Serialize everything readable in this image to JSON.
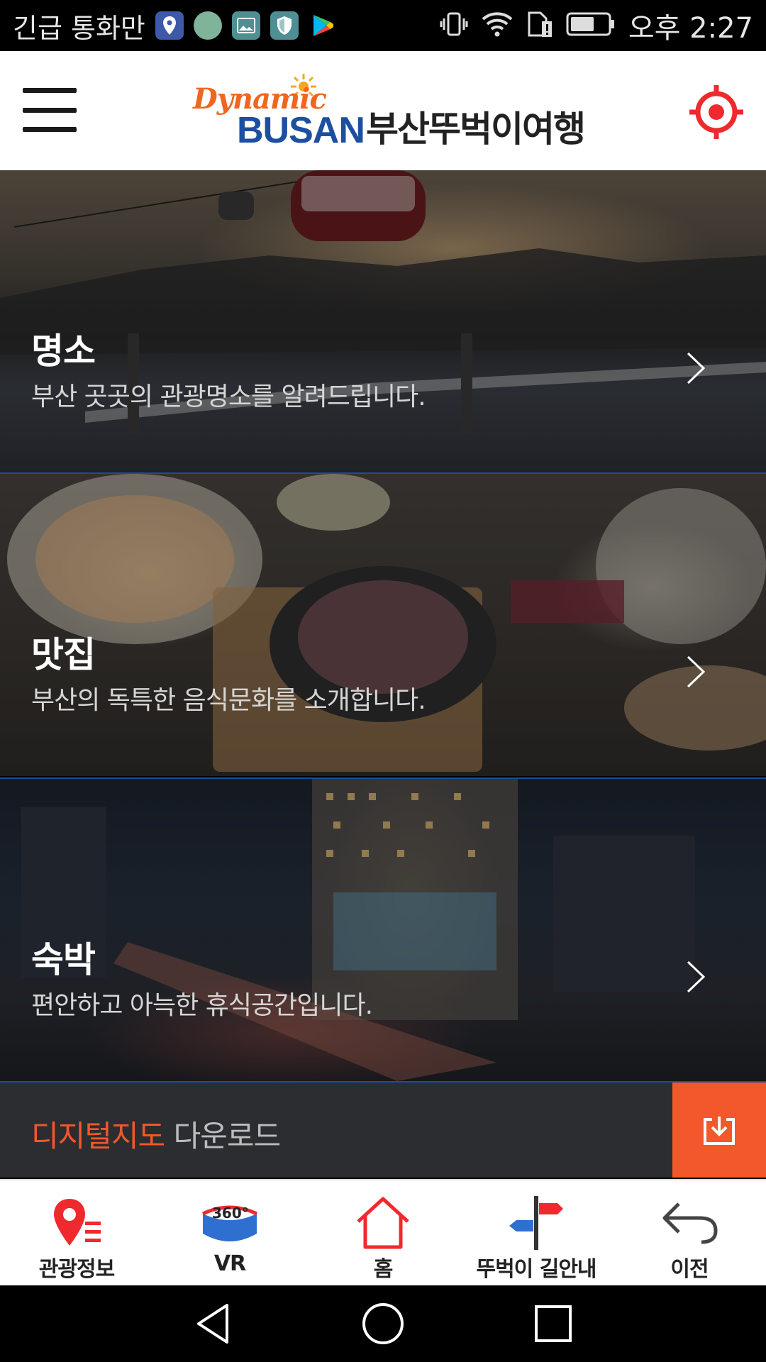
{
  "status_bar": {
    "carrier_text": "긴급 통화만",
    "time": "오후 2:27",
    "icons": [
      "map-pin-app-icon",
      "avatar-app-icon",
      "gallery-app-icon",
      "shield-app-icon",
      "play-store-icon",
      "vibrate-icon",
      "wifi-icon",
      "sim-alert-icon",
      "battery-icon"
    ]
  },
  "header": {
    "logo_dynamic": "Dynamic",
    "logo_busan": "BUSAN",
    "title": "부산뚜벅이여행",
    "menu_icon": "hamburger-menu-icon",
    "locate_icon": "crosshair-target-icon",
    "brand_color": "#ee2a2e"
  },
  "categories": [
    {
      "title": "명소",
      "description": "부산 곳곳의 관광명소를 알려드립니다."
    },
    {
      "title": "맛집",
      "description": "부산의 독특한 음식문화를 소개합니다."
    },
    {
      "title": "숙박",
      "description": "편안하고 아늑한 휴식공간입니다."
    }
  ],
  "download": {
    "highlight": "디지털지도",
    "rest": "다운로드",
    "accent": "#f2582b"
  },
  "bottom_nav": [
    {
      "label": "관광정보",
      "icon": "map-pin-list-icon"
    },
    {
      "label": "VR",
      "icon": "vr-360-icon",
      "icon_text": "360°"
    },
    {
      "label": "홈",
      "icon": "home-icon"
    },
    {
      "label": "뚜벅이 길안내",
      "icon": "signpost-icon"
    },
    {
      "label": "이전",
      "icon": "back-arrow-icon"
    }
  ],
  "system_nav": [
    "back-triangle-icon",
    "home-circle-icon",
    "recents-square-icon"
  ]
}
